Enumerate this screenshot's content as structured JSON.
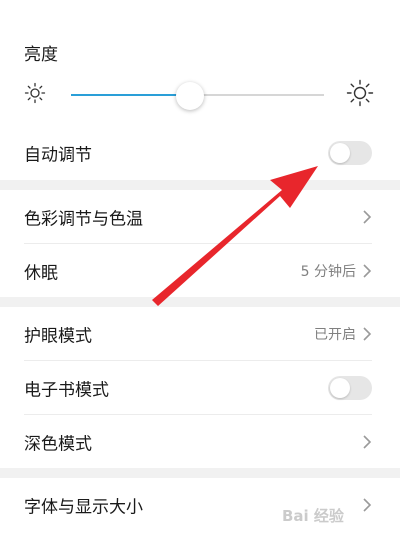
{
  "brightness": {
    "title": "亮度",
    "level": 0.47
  },
  "rows": {
    "auto_adjust": {
      "label": "自动调节",
      "toggle_on": false
    },
    "color_temp": {
      "label": "色彩调节与色温"
    },
    "sleep": {
      "label": "休眠",
      "value": "5 分钟后"
    },
    "eye_protect": {
      "label": "护眼模式",
      "value": "已开启"
    },
    "ebook": {
      "label": "电子书模式",
      "toggle_on": false
    },
    "dark_mode": {
      "label": "深色模式"
    },
    "font_size": {
      "label": "字体与显示大小"
    }
  },
  "watermark": "Bai 经验",
  "colors": {
    "accent": "#2a9fd8",
    "annotation_arrow": "#e8262c"
  },
  "icons": {
    "brightness_low": "sun-small-icon",
    "brightness_high": "sun-large-icon",
    "chevron": "chevron-right-icon",
    "annotation": "red-arrow-icon"
  }
}
